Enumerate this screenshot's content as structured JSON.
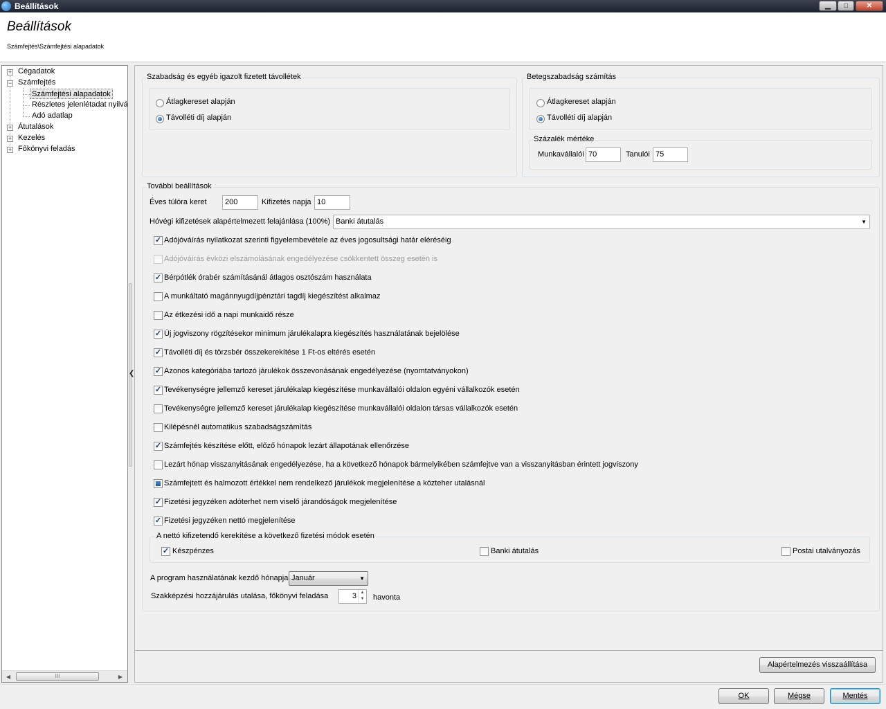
{
  "window": {
    "title": "Beállítások",
    "minimize_glyph": "▁",
    "maximize_glyph": "□",
    "close_glyph": "✕"
  },
  "header": {
    "title": "Beállítások",
    "breadcrumb": "Számfejtés\\Számfejtési alapadatok"
  },
  "tree": {
    "items": [
      {
        "label": "Cégadatok",
        "expander": "+"
      },
      {
        "label": "Számfejtés",
        "expander": "−"
      },
      {
        "label": "Számfejtési alapadatok"
      },
      {
        "label": "Részletes jelenlétadat nyilvá"
      },
      {
        "label": "Adó adatlap"
      },
      {
        "label": "Átutalások",
        "expander": "+"
      },
      {
        "label": "Kezelés",
        "expander": "+"
      },
      {
        "label": "Főkönyvi feladás",
        "expander": "+"
      }
    ],
    "scroll_left": "◀",
    "scroll_right": "▶",
    "scroll_grip": "III"
  },
  "splitter": {
    "arrow": "❮"
  },
  "szabadsag": {
    "title": "Szabadság és egyéb igazolt fizetett távollétek",
    "options": [
      "Átlagkereset alapján",
      "Távolléti díj alapján"
    ],
    "selected": 1
  },
  "betegszabadsag": {
    "title": "Betegszabadság számítás",
    "options": [
      "Átlagkereset alapján",
      "Távolléti díj alapján"
    ],
    "selected": 1,
    "percent_group_title": "Százalék mértéke",
    "munkavallaloi_label": "Munkavállalói",
    "munkavallaloi_value": "70",
    "tanuloi_label": "Tanulói",
    "tanuloi_value": "75"
  },
  "tovabbi": {
    "title": "További beállítások",
    "eves_tulora_label": "Éves túlóra keret",
    "eves_tulora_value": "200",
    "kifizetes_napja_label": "Kifizetés napja",
    "kifizetes_napja_value": "10",
    "hovegi_label": "Hóvégi kifizetések alapértelmezett felajánlása (100%)",
    "hovegi_value": "Banki átutalás",
    "checkboxes": [
      {
        "label": "Adójóváírás nyilatkozat szerinti figyelembevétele az éves jogosultsági határ eléréséig",
        "state": "checked"
      },
      {
        "label": "Adójóváírás évközi elszámolásának engedélyezése csökkentett összeg esetén is",
        "state": "disabled"
      },
      {
        "label": "Bérpótlék órabér számításánál átlagos osztószám használata",
        "state": "checked"
      },
      {
        "label": "A munkáltató magánnyugdíjpénztári tagdíj kiegészítést alkalmaz",
        "state": "unchecked"
      },
      {
        "label": "Az étkezési idő a napi munkaidő része",
        "state": "unchecked"
      },
      {
        "label": "Új jogviszony rögzítésekor minimum járulékalapra kiegészítés használatának bejelölése",
        "state": "checked"
      },
      {
        "label": "Távolléti díj és törzsbér összekerekítése 1 Ft-os eltérés esetén",
        "state": "checked"
      },
      {
        "label": "Azonos kategóriába tartozó járulékok összevonásának engedélyezése (nyomtatványokon)",
        "state": "checked"
      },
      {
        "label": "Tevékenységre jellemző kereset járulékalap kiegészítése munkavállalói oldalon egyéni vállalkozók esetén",
        "state": "checked"
      },
      {
        "label": "Tevékenységre jellemző kereset járulékalap kiegészítése munkavállalói oldalon társas vállalkozók esetén",
        "state": "unchecked"
      },
      {
        "label": "Kilépésnél automatikus szabadságszámítás",
        "state": "unchecked"
      },
      {
        "label": "Számfejtés készítése előtt, előző hónapok lezárt állapotának ellenőrzése",
        "state": "checked"
      },
      {
        "label": "Lezárt hónap visszanyitásának engedélyezése, ha a következő hónapok bármelyikében számfejtve van a visszanyitásban érintett jogviszony",
        "state": "unchecked"
      },
      {
        "label": "Számfejtett és halmozott értékkel nem rendelkező járulékok megjelenítése a közteher utalásnál",
        "state": "indeterminate"
      },
      {
        "label": "Fizetési jegyzéken adóterhet nem viselő járandóságok megjelenítése",
        "state": "checked"
      },
      {
        "label": "Fizetési jegyzéken nettó megjelenítése",
        "state": "checked"
      }
    ],
    "kerekites": {
      "title": "A nettó kifizetendő kerekítése a következő fizetési módok esetén",
      "options": [
        {
          "label": "Készpénzes",
          "checked": true
        },
        {
          "label": "Banki átutalás",
          "checked": false
        },
        {
          "label": "Postai utalványozás",
          "checked": false
        }
      ]
    },
    "kezdo_honap_label": "A program használatának kezdő hónapja",
    "kezdo_honap_value": "Január",
    "szakkepzesi_label": "Szakképzési hozzájárulás utalása, főkönyvi feladása",
    "szakkepzesi_value": "3",
    "szakkepzesi_unit": "havonta",
    "check_glyph": "✓",
    "dropdown_glyph": "▼",
    "spin_up": "▲",
    "spin_down": "▼"
  },
  "reset_button": "Alapértelmezés visszaállítása",
  "footer": {
    "ok": "OK",
    "cancel": "Mégse",
    "save": "Mentés"
  }
}
